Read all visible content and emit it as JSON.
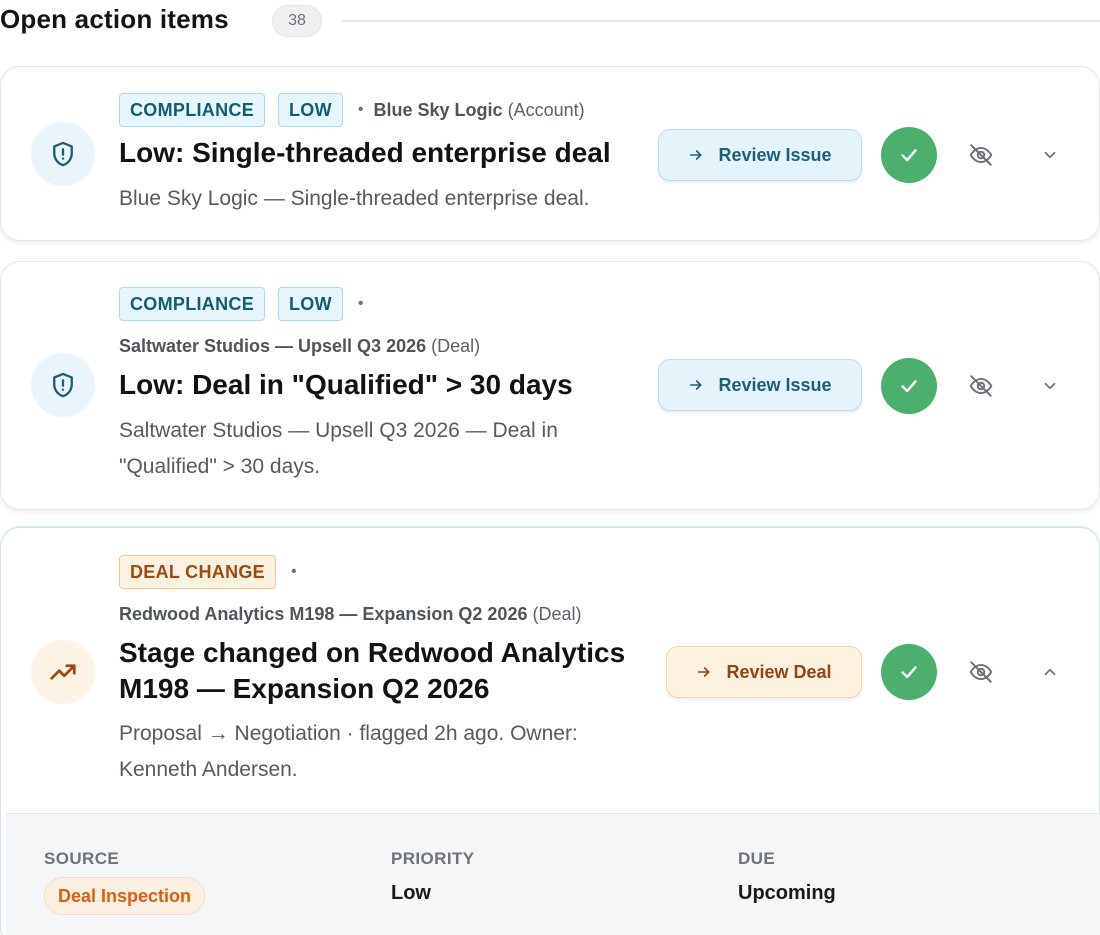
{
  "header": {
    "title": "Open action items",
    "count": "38"
  },
  "items": [
    {
      "tags": [
        "COMPLIANCE",
        "LOW"
      ],
      "entity_name": "Blue Sky Logic",
      "entity_type": "(Account)",
      "title": "Low: Single-threaded enterprise deal",
      "description": "Blue Sky Logic — Single-threaded enterprise deal.",
      "icon": "shield-alert-icon",
      "action_label": "Review Issue",
      "expanded": false
    },
    {
      "tags": [
        "COMPLIANCE",
        "LOW"
      ],
      "entity_name": "Saltwater Studios — Upsell Q3 2026",
      "entity_type": "(Deal)",
      "title": "Low: Deal in \"Qualified\" > 30 days",
      "description_line1": "Saltwater Studios — Upsell Q3 2026 — Deal in",
      "description_line2": "\"Qualified\" > 30 days.",
      "icon": "shield-alert-icon",
      "action_label": "Review Issue",
      "expanded": false
    },
    {
      "tags": [
        "DEAL CHANGE"
      ],
      "entity_name": "Redwood Analytics M198 — Expansion Q2 2026",
      "entity_type": "(Deal)",
      "title_line1": "Stage changed on Redwood Analytics",
      "title_line2": "M198 — Expansion Q2 2026",
      "description_line1": "Proposal → Negotiation · flagged 2h ago. Owner:",
      "description_line2": "Kenneth Andersen.",
      "icon": "trending-up-icon",
      "action_label": "Review Deal",
      "expanded": true,
      "details": {
        "source_label": "SOURCE",
        "source_value": "Deal Inspection",
        "priority_label": "PRIORITY",
        "priority_value": "Low",
        "due_label": "DUE",
        "due_value": "Upcoming"
      }
    }
  ],
  "separator": "•",
  "colors": {
    "compliance_tag": "#145c70",
    "deal_change_tag": "#9a4a12",
    "done_green": "#4caf6e",
    "source_orange": "#e05a12"
  }
}
